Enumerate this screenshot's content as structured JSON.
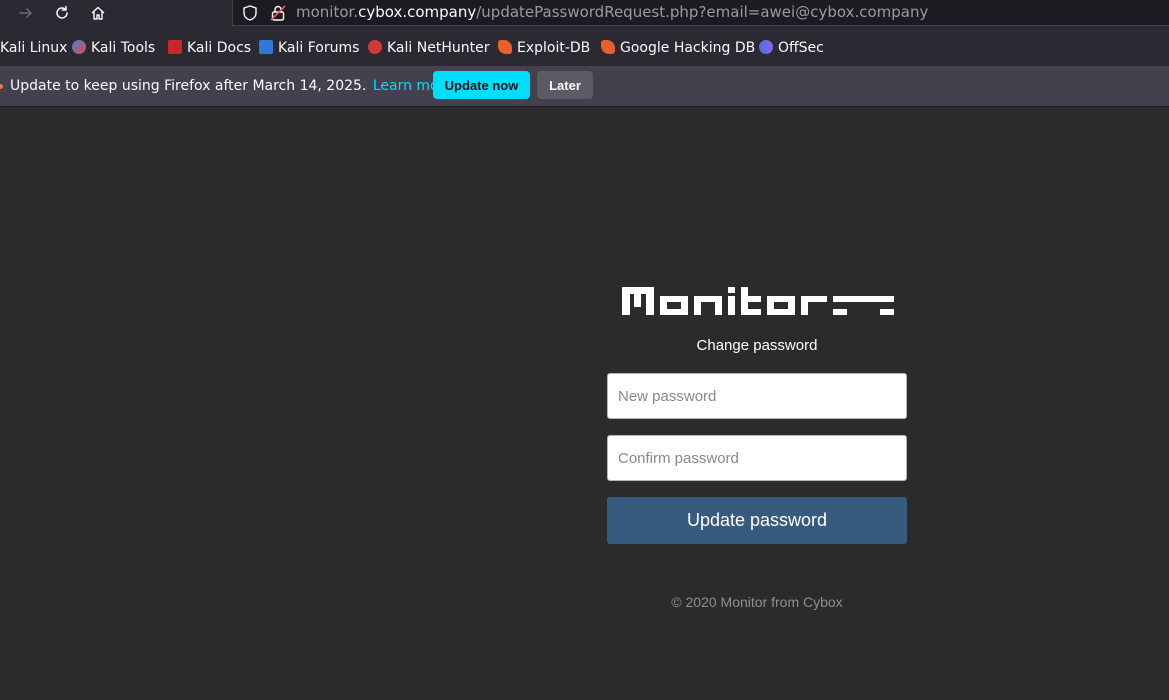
{
  "browser": {
    "url_prefix": "monitor.",
    "url_host": "cybox.company",
    "url_path": "/updatePasswordRequest.php?email=awei@cybox.company",
    "bookmarks": [
      {
        "label": "Kali Linux",
        "icon": "kali-dragon-icon"
      },
      {
        "label": "Kali Tools",
        "icon": "kali-tools-icon"
      },
      {
        "label": "Kali Docs",
        "icon": "kali-docs-icon"
      },
      {
        "label": "Kali Forums",
        "icon": "kali-forums-icon"
      },
      {
        "label": "Kali NetHunter",
        "icon": "kali-nethunter-icon"
      },
      {
        "label": "Exploit-DB",
        "icon": "exploit-db-icon"
      },
      {
        "label": "Google Hacking DB",
        "icon": "ghdb-icon"
      },
      {
        "label": "OffSec",
        "icon": "offsec-icon"
      }
    ],
    "notification": {
      "message": "Update to keep using Firefox after March 14, 2025.",
      "link": "Learn more",
      "primary_button": "Update now",
      "secondary_button": "Later"
    }
  },
  "page": {
    "logo_text": "Monitor",
    "subtitle": "Change password",
    "new_password_placeholder": "New password",
    "confirm_password_placeholder": "Confirm password",
    "submit_label": "Update password",
    "copyright": "© 2020 Monitor from Cybox"
  },
  "colors": {
    "page_background": "#2b2b2b",
    "submit_button": "#375a7f",
    "notification_primary": "#00ddff"
  }
}
